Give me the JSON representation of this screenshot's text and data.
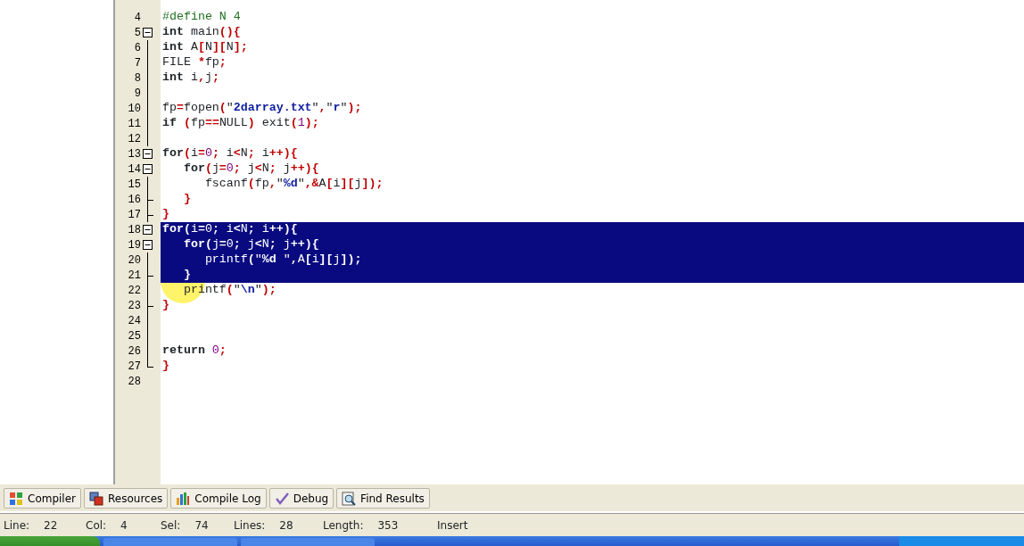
{
  "editor": {
    "lines": [
      {
        "number": "4",
        "fold_toggle": false,
        "block_end": false,
        "selected": false,
        "tokens": [
          {
            "kind": "preproc",
            "text": "#define N 4"
          }
        ]
      },
      {
        "number": "5",
        "fold_toggle": true,
        "block_end": false,
        "selected": false,
        "tokens": [
          {
            "kind": "keyword",
            "text": "int"
          },
          {
            "kind": "plain",
            "text": " main"
          },
          {
            "kind": "sym",
            "text": "(){"
          }
        ]
      },
      {
        "number": "6",
        "fold_toggle": false,
        "block_end": false,
        "selected": false,
        "tokens": [
          {
            "kind": "keyword",
            "text": "int"
          },
          {
            "kind": "plain",
            "text": " A"
          },
          {
            "kind": "sym",
            "text": "["
          },
          {
            "kind": "plain",
            "text": "N"
          },
          {
            "kind": "sym",
            "text": "]["
          },
          {
            "kind": "plain",
            "text": "N"
          },
          {
            "kind": "sym",
            "text": "];"
          }
        ]
      },
      {
        "number": "7",
        "fold_toggle": false,
        "block_end": false,
        "selected": false,
        "tokens": [
          {
            "kind": "plain",
            "text": "FILE "
          },
          {
            "kind": "sym",
            "text": "*"
          },
          {
            "kind": "plain",
            "text": "fp"
          },
          {
            "kind": "sym",
            "text": ";"
          }
        ]
      },
      {
        "number": "8",
        "fold_toggle": false,
        "block_end": false,
        "selected": false,
        "tokens": [
          {
            "kind": "keyword",
            "text": "int"
          },
          {
            "kind": "plain",
            "text": " i"
          },
          {
            "kind": "sym",
            "text": ","
          },
          {
            "kind": "plain",
            "text": "j"
          },
          {
            "kind": "sym",
            "text": ";"
          }
        ]
      },
      {
        "number": "9",
        "fold_toggle": false,
        "block_end": false,
        "selected": false
      },
      {
        "number": "10",
        "fold_toggle": false,
        "block_end": false,
        "selected": false,
        "tokens": [
          {
            "kind": "plain",
            "text": "fp"
          },
          {
            "kind": "sym",
            "text": "="
          },
          {
            "kind": "plain",
            "text": "fopen"
          },
          {
            "kind": "sym",
            "text": "("
          },
          {
            "kind": "plain",
            "text": "\""
          },
          {
            "kind": "string",
            "text": "2darray.txt"
          },
          {
            "kind": "plain",
            "text": "\""
          },
          {
            "kind": "sym",
            "text": ","
          },
          {
            "kind": "plain",
            "text": "\""
          },
          {
            "kind": "string",
            "text": "r"
          },
          {
            "kind": "plain",
            "text": "\""
          },
          {
            "kind": "sym",
            "text": ");"
          }
        ]
      },
      {
        "number": "11",
        "fold_toggle": false,
        "block_end": false,
        "selected": false,
        "tokens": [
          {
            "kind": "keyword",
            "text": "if"
          },
          {
            "kind": "sym",
            "text": " ("
          },
          {
            "kind": "plain",
            "text": "fp"
          },
          {
            "kind": "sym",
            "text": "=="
          },
          {
            "kind": "plain",
            "text": "NULL"
          },
          {
            "kind": "sym",
            "text": ")"
          },
          {
            "kind": "plain",
            "text": " exit"
          },
          {
            "kind": "sym",
            "text": "("
          },
          {
            "kind": "number",
            "text": "1"
          },
          {
            "kind": "sym",
            "text": ");"
          }
        ]
      },
      {
        "number": "12",
        "fold_toggle": false,
        "block_end": false,
        "selected": false
      },
      {
        "number": "13",
        "fold_toggle": true,
        "block_end": false,
        "selected": false,
        "tokens": [
          {
            "kind": "keyword",
            "text": "for"
          },
          {
            "kind": "sym",
            "text": "("
          },
          {
            "kind": "plain",
            "text": "i"
          },
          {
            "kind": "sym",
            "text": "="
          },
          {
            "kind": "number",
            "text": "0"
          },
          {
            "kind": "sym",
            "text": ";"
          },
          {
            "kind": "plain",
            "text": " i"
          },
          {
            "kind": "sym",
            "text": "<"
          },
          {
            "kind": "plain",
            "text": "N"
          },
          {
            "kind": "sym",
            "text": ";"
          },
          {
            "kind": "plain",
            "text": " i"
          },
          {
            "kind": "sym",
            "text": "++){"
          }
        ]
      },
      {
        "number": "14",
        "fold_toggle": true,
        "block_end": false,
        "selected": false,
        "tokens": [
          {
            "kind": "keyword",
            "text": "   for"
          },
          {
            "kind": "sym",
            "text": "("
          },
          {
            "kind": "plain",
            "text": "j"
          },
          {
            "kind": "sym",
            "text": "="
          },
          {
            "kind": "number",
            "text": "0"
          },
          {
            "kind": "sym",
            "text": ";"
          },
          {
            "kind": "plain",
            "text": " j"
          },
          {
            "kind": "sym",
            "text": "<"
          },
          {
            "kind": "plain",
            "text": "N"
          },
          {
            "kind": "sym",
            "text": ";"
          },
          {
            "kind": "plain",
            "text": " j"
          },
          {
            "kind": "sym",
            "text": "++){"
          }
        ]
      },
      {
        "number": "15",
        "fold_toggle": false,
        "block_end": false,
        "selected": false,
        "tokens": [
          {
            "kind": "plain",
            "text": "      fscanf"
          },
          {
            "kind": "sym",
            "text": "("
          },
          {
            "kind": "plain",
            "text": "fp"
          },
          {
            "kind": "sym",
            "text": ","
          },
          {
            "kind": "plain",
            "text": "\""
          },
          {
            "kind": "string",
            "text": "%d"
          },
          {
            "kind": "plain",
            "text": "\""
          },
          {
            "kind": "sym",
            "text": ",&"
          },
          {
            "kind": "plain",
            "text": "A"
          },
          {
            "kind": "sym",
            "text": "["
          },
          {
            "kind": "plain",
            "text": "i"
          },
          {
            "kind": "sym",
            "text": "]["
          },
          {
            "kind": "plain",
            "text": "j"
          },
          {
            "kind": "sym",
            "text": "]);"
          }
        ]
      },
      {
        "number": "16",
        "fold_toggle": false,
        "block_end": true,
        "selected": false,
        "tokens": [
          {
            "kind": "sym",
            "text": "   }"
          }
        ]
      },
      {
        "number": "17",
        "fold_toggle": false,
        "block_end": true,
        "selected": false,
        "tokens": [
          {
            "kind": "sym",
            "text": "}"
          }
        ]
      },
      {
        "number": "18",
        "fold_toggle": true,
        "block_end": false,
        "selected": true,
        "tokens": [
          {
            "kind": "keyword",
            "text": "for"
          },
          {
            "kind": "sym",
            "text": "("
          },
          {
            "kind": "plain",
            "text": "i"
          },
          {
            "kind": "sym",
            "text": "="
          },
          {
            "kind": "number",
            "text": "0"
          },
          {
            "kind": "sym",
            "text": ";"
          },
          {
            "kind": "plain",
            "text": " i"
          },
          {
            "kind": "sym",
            "text": "<"
          },
          {
            "kind": "plain",
            "text": "N"
          },
          {
            "kind": "sym",
            "text": ";"
          },
          {
            "kind": "plain",
            "text": " i"
          },
          {
            "kind": "sym",
            "text": "++){"
          }
        ]
      },
      {
        "number": "19",
        "fold_toggle": true,
        "block_end": false,
        "selected": true,
        "tokens": [
          {
            "kind": "keyword",
            "text": "   for"
          },
          {
            "kind": "sym",
            "text": "("
          },
          {
            "kind": "plain",
            "text": "j"
          },
          {
            "kind": "sym",
            "text": "="
          },
          {
            "kind": "number",
            "text": "0"
          },
          {
            "kind": "sym",
            "text": ";"
          },
          {
            "kind": "plain",
            "text": " j"
          },
          {
            "kind": "sym",
            "text": "<"
          },
          {
            "kind": "plain",
            "text": "N"
          },
          {
            "kind": "sym",
            "text": ";"
          },
          {
            "kind": "plain",
            "text": " j"
          },
          {
            "kind": "sym",
            "text": "++){"
          }
        ]
      },
      {
        "number": "20",
        "fold_toggle": false,
        "block_end": false,
        "selected": true,
        "tokens": [
          {
            "kind": "plain",
            "text": "      printf"
          },
          {
            "kind": "sym",
            "text": "("
          },
          {
            "kind": "plain",
            "text": "\""
          },
          {
            "kind": "string",
            "text": "%d "
          },
          {
            "kind": "plain",
            "text": "\""
          },
          {
            "kind": "sym",
            "text": ","
          },
          {
            "kind": "plain",
            "text": "A"
          },
          {
            "kind": "sym",
            "text": "["
          },
          {
            "kind": "plain",
            "text": "i"
          },
          {
            "kind": "sym",
            "text": "]["
          },
          {
            "kind": "plain",
            "text": "j"
          },
          {
            "kind": "sym",
            "text": "]);"
          }
        ]
      },
      {
        "number": "21",
        "fold_toggle": false,
        "block_end": true,
        "selected": true,
        "tokens": [
          {
            "kind": "sym",
            "text": "   }"
          }
        ]
      },
      {
        "number": "22",
        "fold_toggle": false,
        "block_end": false,
        "selected": false,
        "tokens": [
          {
            "kind": "plain",
            "text": "   printf"
          },
          {
            "kind": "sym",
            "text": "("
          },
          {
            "kind": "plain",
            "text": "\""
          },
          {
            "kind": "string",
            "text": "\\n"
          },
          {
            "kind": "plain",
            "text": "\""
          },
          {
            "kind": "sym",
            "text": ");"
          }
        ]
      },
      {
        "number": "23",
        "fold_toggle": false,
        "block_end": true,
        "selected": false,
        "tokens": [
          {
            "kind": "sym",
            "text": "}"
          }
        ]
      },
      {
        "number": "24",
        "fold_toggle": false,
        "block_end": false,
        "selected": false
      },
      {
        "number": "25",
        "fold_toggle": false,
        "block_end": false,
        "selected": false
      },
      {
        "number": "26",
        "fold_toggle": false,
        "block_end": false,
        "selected": false,
        "tokens": [
          {
            "kind": "keyword",
            "text": "return"
          },
          {
            "kind": "number",
            "text": " 0"
          },
          {
            "kind": "sym",
            "text": ";"
          }
        ]
      },
      {
        "number": "27",
        "fold_toggle": false,
        "block_end": true,
        "selected": false,
        "tokens": [
          {
            "kind": "sym",
            "text": "}"
          }
        ]
      },
      {
        "number": "28",
        "fold_toggle": false,
        "block_end": false,
        "selected": false
      }
    ]
  },
  "bottom_tabs": [
    {
      "label": "Compiler"
    },
    {
      "label": "Resources"
    },
    {
      "label": "Compile Log"
    },
    {
      "label": "Debug"
    },
    {
      "label": "Find Results"
    }
  ],
  "status_bar": [
    {
      "label": "Line:",
      "value": "22"
    },
    {
      "label": "Col:",
      "value": "4"
    },
    {
      "label": "Sel:",
      "value": "74"
    },
    {
      "label": "Lines:",
      "value": "28"
    },
    {
      "label": "Length:",
      "value": "353"
    },
    {
      "value": "Insert"
    }
  ]
}
